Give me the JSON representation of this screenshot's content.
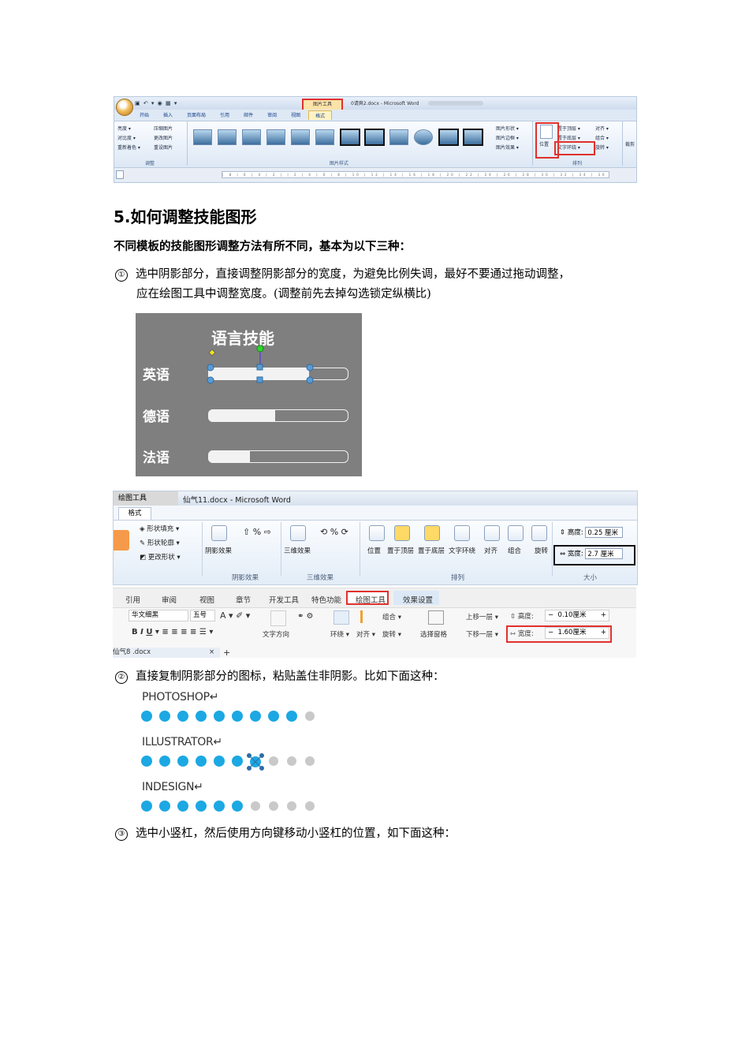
{
  "shot1": {
    "context_tab": "图片工具",
    "doc_title": "0请爽2.docx - Microsoft Word",
    "tabs": [
      "开始",
      "插入",
      "页面布局",
      "引用",
      "邮件",
      "审阅",
      "视图",
      "格式"
    ],
    "adjust_cmds": [
      "亮度 ▾",
      "对比度 ▾",
      "重新着色 ▾",
      "压缩图片",
      "更改图片",
      "重设图片"
    ],
    "style_cmds": [
      "图片形状 ▾",
      "图片边框 ▾",
      "图片效果 ▾"
    ],
    "position_label": "位置",
    "arrange_cmds": [
      "置于顶层 ▾",
      "置于底层 ▾",
      "文字环绕 ▾",
      "对齐 ▾",
      "组合 ▾",
      "旋转 ▾"
    ],
    "crop_label": "裁剪",
    "group_labels": [
      "调整",
      "图片样式",
      "排列"
    ]
  },
  "heading": "5.如何调整技能图形",
  "intro": "不同模板的技能图形调整方法有所不同，基本为以下三种：",
  "step1": {
    "num": "①",
    "line1": "选中阴影部分，直接调整阴影部分的宽度，为避免比例失调，最好不要通过拖动调整，",
    "line2": "应在绘图工具中调整宽度。(调整前先去掉勾选锁定纵横比)"
  },
  "panel": {
    "title": "语言技能",
    "skills": [
      {
        "name": "英语",
        "level": 0.72
      },
      {
        "name": "德语",
        "level": 0.48
      },
      {
        "name": "法语",
        "level": 0.3
      }
    ]
  },
  "shot2": {
    "tool_tab": "绘图工具",
    "doc_title": "仙气11.docx - Microsoft Word",
    "format_tab": "格式",
    "shape_cmds": [
      "形状填充 ▾",
      "形状轮廓 ▾",
      "更改形状 ▾"
    ],
    "shadow_label": "阴影效果",
    "threed_label": "三维效果",
    "arrange_cmds": [
      "位置",
      "置于顶层",
      "置于底层",
      "文字环绕",
      "对齐",
      "组合",
      "旋转"
    ],
    "height_label": "高度:",
    "height_value": "0.25 厘米",
    "width_label": "宽度:",
    "width_value": "2.7 厘米",
    "group_labels": [
      "阴影效果",
      "三维效果",
      "排列",
      "大小"
    ]
  },
  "shot3": {
    "tabs": [
      "引用",
      "审阅",
      "视图",
      "章节",
      "开发工具",
      "特色功能",
      "绘图工具",
      "效果设置"
    ],
    "font_name": "华文细黑",
    "font_size": "五号",
    "cmds": [
      "文字方向",
      "环绕 ▾",
      "对齐 ▾",
      "旋转 ▾",
      "选择窗格",
      "组合 ▾",
      "上移一层 ▾",
      "下移一层 ▾"
    ],
    "height_label": "高度:",
    "height_value": "0.10厘米",
    "width_label": "宽度:",
    "width_value": "1.60厘米",
    "doc_tab": "仙气8 .docx"
  },
  "step2": {
    "num": "②",
    "text": "直接复制阴影部分的图标，粘贴盖住非阴影。比如下面这种："
  },
  "dots": [
    {
      "title": "PHOTOSHOP↵",
      "filled": 9,
      "total": 10
    },
    {
      "title": "ILLUSTRATOR↵",
      "filled": 6,
      "total": 10
    },
    {
      "title": "INDESIGN↵",
      "filled": 6,
      "total": 10
    }
  ],
  "step3": {
    "num": "③",
    "text": "选中小竖杠，然后使用方向键移动小竖杠的位置，如下面这种："
  },
  "colors": {
    "dot_on": "#1ca8e3",
    "dot_off": "#c9c9c9",
    "panel_bg": "#7f7f7f",
    "highlight_red": "#e0312e"
  }
}
